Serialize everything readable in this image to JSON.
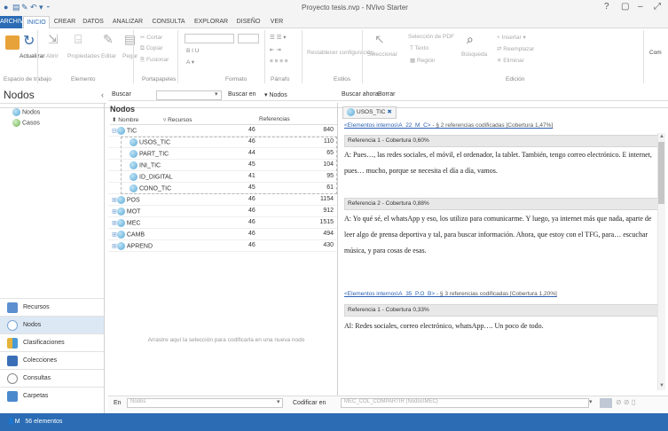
{
  "window": {
    "title": "Proyecto tesis.nvp - NVivo Starter",
    "controls": [
      "?",
      "▢",
      "–",
      "⤢"
    ]
  },
  "quick_access": [
    "●",
    "▤",
    "✎",
    "↶",
    "▾",
    "⁃"
  ],
  "ribbon_tabs": [
    "ARCHIVO",
    "INICIO",
    "CREAR",
    "DATOS",
    "ANALIZAR",
    "CONSULTA",
    "EXPLORAR",
    "DISEÑO",
    "VER"
  ],
  "ribbon": {
    "actualizar": "Actualizar",
    "abrir": "Abrir",
    "propiedades": "Propiedades",
    "editar": "Editar",
    "pegar": "Pegar",
    "cortar": "Cortar",
    "copiar": "Copiar",
    "fusionar": "Fusionar",
    "formato_icons": "B  I  U",
    "restablecer": "Restablecer configuración",
    "seleccionar": "Seleccionar",
    "seleccion_pdf": "Selección de PDF",
    "texto": "Texto",
    "region": "Región",
    "busqueda": "Búsqueda",
    "insertar": "Insertar",
    "reemplazar": "Reemplazar",
    "eliminar": "Eliminar",
    "com": "Com",
    "groups": [
      "Espacio de trabajo",
      "Elemento",
      "Portapapeles",
      "Formato",
      "Párrafo",
      "Estilos",
      "Edición"
    ]
  },
  "sidebar": {
    "title": "Nodos",
    "tree": [
      "Nodos",
      "Casos"
    ],
    "buttons": [
      "Recursos",
      "Nodos",
      "Clasificaciones",
      "Colecciones",
      "Consultas",
      "Carpetas"
    ]
  },
  "findbar": {
    "buscar": "Buscar",
    "buscar_en": "Buscar en",
    "scope": "Nodos",
    "buscar_ahora": "Buscar ahora",
    "borrar": "Borrar"
  },
  "grid": {
    "title": "Nodos",
    "columns": [
      "Nombre",
      "Recursos",
      "Referencias"
    ],
    "rows": [
      {
        "name": "TIC",
        "recursos": "46",
        "refs": "840",
        "level": 0,
        "exp": "⊟"
      },
      {
        "name": "USOS_TIC",
        "recursos": "46",
        "refs": "110",
        "level": 1,
        "exp": ""
      },
      {
        "name": "PART_TIC",
        "recursos": "44",
        "refs": "65",
        "level": 1,
        "exp": ""
      },
      {
        "name": "INI_TIC",
        "recursos": "45",
        "refs": "104",
        "level": 1,
        "exp": ""
      },
      {
        "name": "ID_DIGITAL",
        "recursos": "41",
        "refs": "95",
        "level": 1,
        "exp": ""
      },
      {
        "name": "CONO_TIC",
        "recursos": "45",
        "refs": "61",
        "level": 1,
        "exp": ""
      },
      {
        "name": "POS",
        "recursos": "46",
        "refs": "1154",
        "level": 0,
        "exp": "⊞"
      },
      {
        "name": "MOT",
        "recursos": "46",
        "refs": "912",
        "level": 0,
        "exp": "⊞"
      },
      {
        "name": "MEC",
        "recursos": "46",
        "refs": "1515",
        "level": 0,
        "exp": "⊞"
      },
      {
        "name": "CAMB",
        "recursos": "46",
        "refs": "494",
        "level": 0,
        "exp": "⊞"
      },
      {
        "name": "APREND",
        "recursos": "46",
        "refs": "430",
        "level": 0,
        "exp": "⊞"
      }
    ],
    "drop_hint": "Arrastre aquí la selección para codificarla en una nueva nodo"
  },
  "detail": {
    "tab": "USOS_TIC",
    "link1": "<Elementos internos\\A_22_M_C>",
    "link1_tail": " - § 2 referencias codificadas  [Cobertura 1,47%]",
    "ref1": "Referencia 1 - Cobertura 0,60%",
    "text1": "A: Pues…, las redes sociales, el móvil, el ordenador, la tablet. También, tengo correo electrónico. E internet, pues… mucho, porque se necesita el día a día, vamos.",
    "ref2": "Referencia 2 - Cobertura 0,88%",
    "text2": "A: Yo qué sé, el whatsApp y eso, los utilizo para comunicarme. Y luego, ya internet más que nada, aparte de leer algo de prensa deportiva y tal, para buscar información. Ahora, que estoy con el TFG, para… escuchar música, y para cosas de esas.",
    "link2": "<Elementos internos\\A_35_P.O_B>",
    "link2_tail": " - § 3 referencias codificadas  [Cobertura 1,20%]",
    "ref3": "Referencia 1 - Cobertura 0,33%",
    "text3": "Al: Redes sociales, correo electrónico, whatsApp…. Un poco de todo."
  },
  "bottom": {
    "en": "En",
    "en_value": "Nodos",
    "codificar_en": "Codificar en",
    "code_value": "MEC_COL_COMPARTIR (Nodos\\MEC)"
  },
  "status": {
    "text": "56 elementos",
    "user": "M"
  }
}
